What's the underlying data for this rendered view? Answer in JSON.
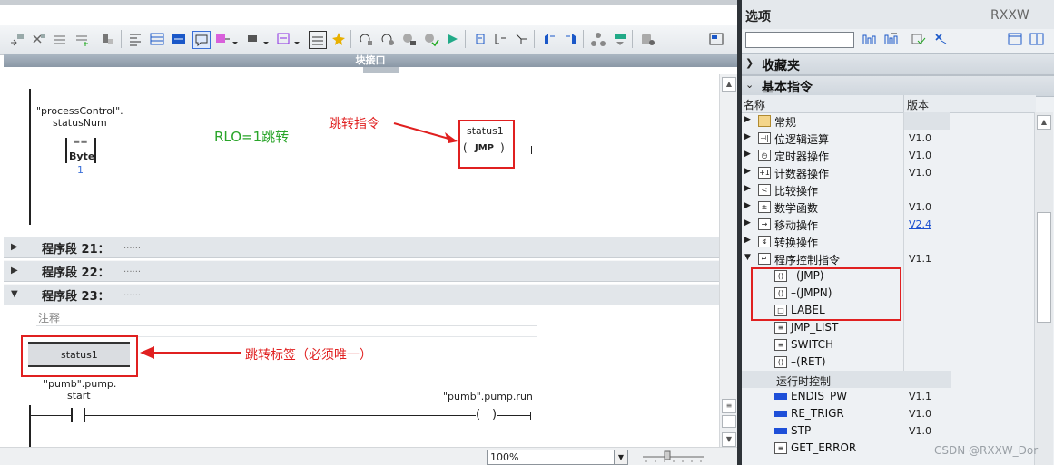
{
  "toolbar": {
    "icons": [
      "insert-network-icon",
      "delete-network-icon",
      "insert-row-icon",
      "add-row-icon",
      "monitor-icon",
      "absolute-operands-icon",
      "show-favorites-icon",
      "favorite-icon",
      "comment-icon",
      "goto-error-icon",
      "show-symbols-icon",
      "show-addresses-icon",
      "toggle-comments-icon",
      "instruction-icon",
      "open-all-networks-icon",
      "close-all-networks-icon",
      "go-to-start-icon",
      "go-to-end-icon",
      "preview-icon",
      "record-icon",
      "bookmark-icon",
      "download-icon",
      "monitoring-on-icon",
      "layout-icon"
    ]
  },
  "block_interface": {
    "label": "块接口"
  },
  "network20": {
    "operand": "\"processControl\".\nstatusNum",
    "operand_line1": "\"processControl\".",
    "operand_line2": "statusNum",
    "compare_op": "==",
    "compare_type": "Byte",
    "compare_value": "1",
    "rlo_note": "RLO=1跳转",
    "jump_annot": "跳转指令",
    "jump_label": "status1",
    "jump_coil": "JMP"
  },
  "networks": [
    {
      "label": "程序段 21：",
      "dots": "......",
      "expanded": false
    },
    {
      "label": "程序段 22：",
      "dots": "......",
      "expanded": false
    },
    {
      "label": "程序段 23：",
      "dots": "......",
      "expanded": true
    }
  ],
  "network23": {
    "comment_placeholder": "注释",
    "label_box": "status1",
    "label_annot": "跳转标签（必须唯一）",
    "contact_line1": "\"pumb\".pump.",
    "contact_line2": "start",
    "coil_operand": "\"pumb\".pump.run"
  },
  "zoom": {
    "value": "100%"
  },
  "right_panel": {
    "title": "选项",
    "user": "RXXW",
    "favorites": "收藏夹",
    "basic_instructions": "基本指令",
    "col_name": "名称",
    "col_version": "版本",
    "tree": [
      {
        "label": "常规",
        "version": "",
        "icon": "folder-icon"
      },
      {
        "label": "位逻辑运算",
        "version": "V1.0",
        "icon": "bit-logic-icon"
      },
      {
        "label": "定时器操作",
        "version": "V1.0",
        "icon": "timer-icon"
      },
      {
        "label": "计数器操作",
        "version": "V1.0",
        "icon": "counter-icon"
      },
      {
        "label": "比较操作",
        "version": "",
        "icon": "compare-icon"
      },
      {
        "label": "数学函数",
        "version": "V1.0",
        "icon": "math-icon"
      },
      {
        "label": "移动操作",
        "version": "V2.4",
        "icon": "move-icon",
        "version_link": true
      },
      {
        "label": "转换操作",
        "version": "",
        "icon": "convert-icon"
      },
      {
        "label": "程序控制指令",
        "version": "V1.1",
        "icon": "program-control-icon"
      }
    ],
    "program_control_items": [
      {
        "label": "–(JMP)",
        "version": "",
        "icon": "jmp-icon"
      },
      {
        "label": "–(JMPN)",
        "version": "",
        "icon": "jmpn-icon"
      },
      {
        "label": "LABEL",
        "version": "",
        "icon": "label-icon"
      },
      {
        "label": "JMP_LIST",
        "version": "",
        "icon": "jmp-list-icon"
      },
      {
        "label": "SWITCH",
        "version": "",
        "icon": "switch-icon"
      },
      {
        "label": "–(RET)",
        "version": "",
        "icon": "ret-icon"
      }
    ],
    "runtime_group": "运行时控制",
    "runtime_items": [
      {
        "label": "ENDIS_PW",
        "version": "V1.1",
        "icon": "endis-pw-icon"
      },
      {
        "label": "RE_TRIGR",
        "version": "V1.0",
        "icon": "re-trigr-icon"
      },
      {
        "label": "STP",
        "version": "V1.0",
        "icon": "stp-icon"
      },
      {
        "label": "GET_ERROR",
        "version": "",
        "icon": "get-error-icon"
      }
    ]
  },
  "watermark": "CSDN @RXXW_Dor",
  "colors": {
    "annotation_red": "#e02020",
    "rlo_green": "#2aa52a",
    "link_blue": "#1a4fd0"
  }
}
